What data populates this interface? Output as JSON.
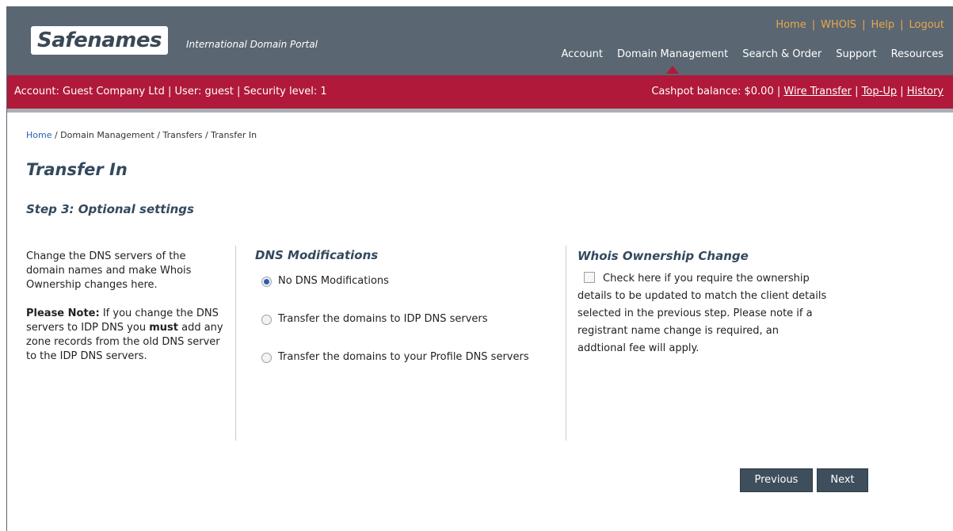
{
  "header": {
    "logo_text": "Safenames",
    "tagline": "International Domain Portal",
    "utility": [
      "Home",
      "WHOIS",
      "Help",
      "Logout"
    ],
    "nav": [
      "Account",
      "Domain Management",
      "Search & Order",
      "Support",
      "Resources"
    ],
    "active_nav": "Domain Management"
  },
  "account_bar": {
    "account": "Account: Guest Company Ltd",
    "user": "User: guest",
    "security": "Security level: 1",
    "cashpot": "Cashpot balance: $0.00",
    "wire": "Wire Transfer",
    "topup": "Top-Up",
    "history": "History"
  },
  "breadcrumb": {
    "home": "Home",
    "rest": " / Domain Management / Transfers / Transfer In"
  },
  "page": {
    "title": "Transfer In",
    "step": "Step 3: Optional settings"
  },
  "intro": {
    "p1": "Change the DNS servers of the domain names and make Whois Ownership changes here.",
    "note_label": "Please Note:",
    "note_a": " If you change the DNS servers to IDP DNS you ",
    "note_must": "must",
    "note_b": " add any zone records from the old DNS server to the IDP DNS servers."
  },
  "dns": {
    "title": "DNS Modifications",
    "options": [
      {
        "label": "No DNS Modifications",
        "checked": true
      },
      {
        "label": "Transfer the domains to IDP DNS servers",
        "checked": false
      },
      {
        "label": "Transfer the domains to your Profile DNS servers",
        "checked": false
      }
    ]
  },
  "whois": {
    "title": "Whois Ownership Change",
    "text": "Check here if you require the ownership details to be updated to match the client details selected in the previous step. Please note if a registrant name change is required, an addtional fee will apply.",
    "checked": false
  },
  "buttons": {
    "previous": "Previous",
    "next": "Next"
  },
  "colors": {
    "header_bg": "#5a6672",
    "account_bar_bg": "#b0193a",
    "utility_link": "#e8a84a",
    "heading": "#34495e",
    "button_bg": "#3e4e5c"
  }
}
